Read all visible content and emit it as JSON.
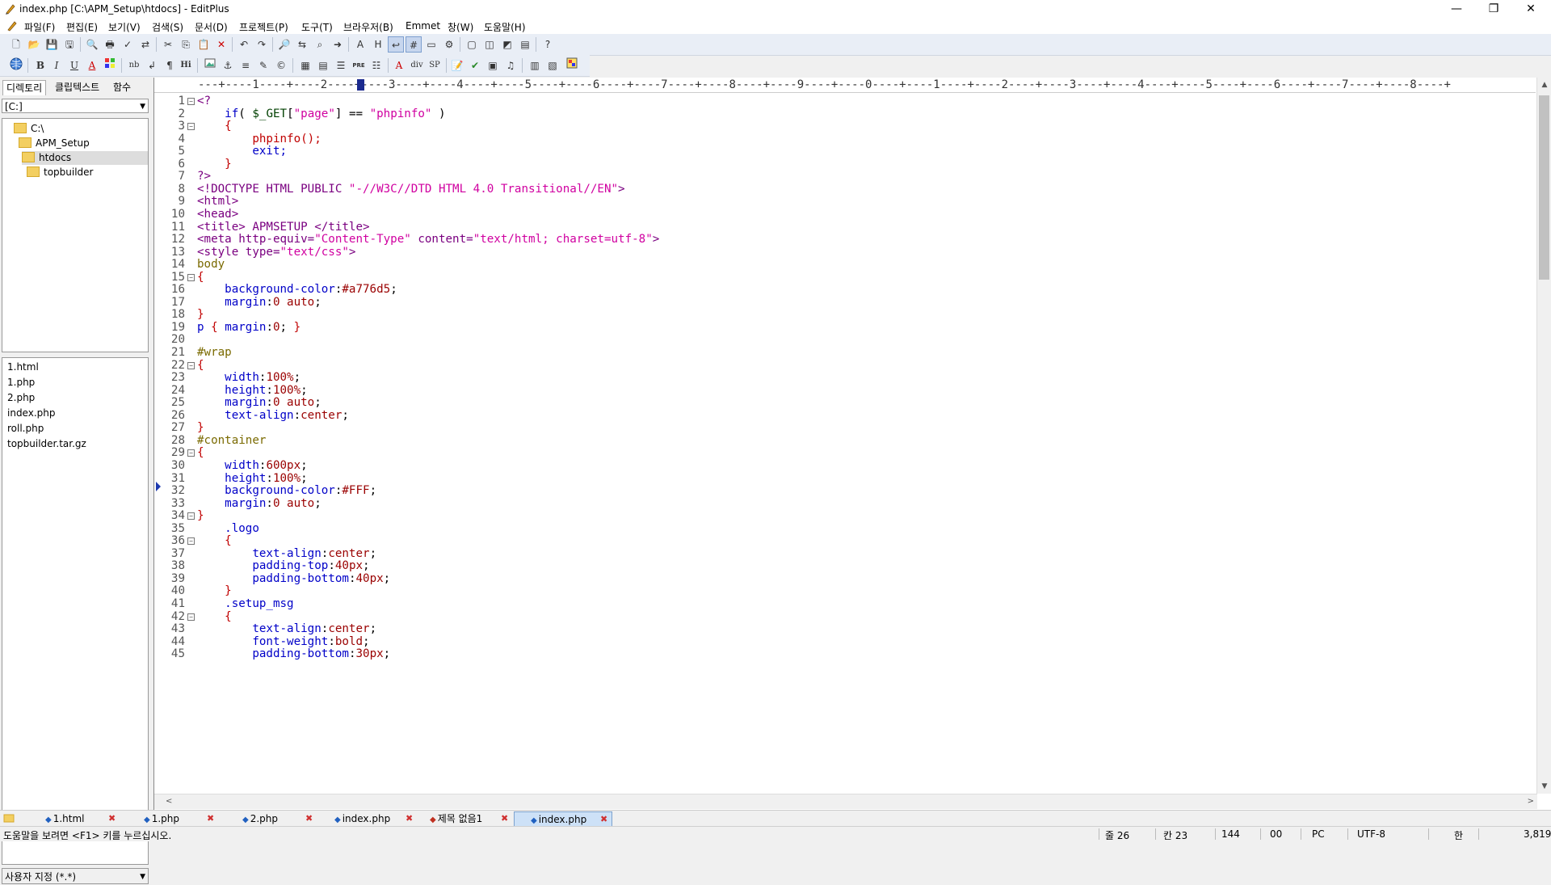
{
  "window": {
    "title": "index.php [C:\\APM_Setup\\htdocs] - EditPlus",
    "minimize": "—",
    "restore": "❐",
    "close": "✕"
  },
  "menu": [
    "파일(F)",
    "편집(E)",
    "보기(V)",
    "검색(S)",
    "문서(D)",
    "프로젝트(P)",
    "도구(T)",
    "브라우저(B)",
    "Emmet",
    "창(W)",
    "도움말(H)"
  ],
  "toolbar": {
    "row1_icons": [
      "new-file-icon",
      "open-file-icon",
      "save-icon",
      "save-all-icon",
      "print-preview-icon",
      "print-icon",
      "spell-check-icon",
      "ftp-icon",
      "cut-icon",
      "copy-icon",
      "paste-icon",
      "delete-icon",
      "undo-icon",
      "redo-icon",
      "find-icon",
      "replace-icon",
      "find-in-files-icon",
      "goto-icon",
      "font-icon",
      "heading-icon",
      "word-wrap-icon",
      "line-numbers-icon",
      "ruler-icon",
      "settings-icon",
      "window-icon",
      "split-icon",
      "browser-icon",
      "directory-icon",
      "help-icon"
    ],
    "row2": [
      "B",
      "I",
      "U",
      "A",
      "nb",
      "¶",
      "Hi",
      "div",
      "SP",
      "PRE"
    ]
  },
  "left_panel": {
    "tabs": [
      "디렉토리",
      "클립텍스트",
      "함수"
    ],
    "drive": "[C:]",
    "tree": [
      "C:\\",
      "APM_Setup",
      "htdocs",
      "topbuilder"
    ],
    "files": [
      "1.html",
      "1.php",
      "2.php",
      "index.php",
      "roll.php",
      "topbuilder.tar.gz"
    ],
    "filter": "사용자 지정 (*.*)"
  },
  "editor": {
    "ruler": "---+----1----+----2----+----3----+----4----+----5----+----6----+----7----+----8----+----9----+----0----+----1----+----2----+----3----+----4----+----5----+----6----+----7----+----8----+"
  },
  "code_lines": [
    {
      "n": "1",
      "fold": true,
      "t": "<?"
    },
    {
      "n": "2",
      "t": "    if( $_GET[\"page\"] == \"phpinfo\" )"
    },
    {
      "n": "3",
      "fold": true,
      "t": "    {"
    },
    {
      "n": "4",
      "t": "        phpinfo();"
    },
    {
      "n": "5",
      "t": "        exit;"
    },
    {
      "n": "6",
      "t": "    }"
    },
    {
      "n": "7",
      "t": "?>"
    },
    {
      "n": "8",
      "t": "<!DOCTYPE HTML PUBLIC \"-//W3C//DTD HTML 4.0 Transitional//EN\">"
    },
    {
      "n": "9",
      "t": "<html>"
    },
    {
      "n": "10",
      "t": "<head>"
    },
    {
      "n": "11",
      "t": "<title> APMSETUP </title>"
    },
    {
      "n": "12",
      "t": "<meta http-equiv=\"Content-Type\" content=\"text/html; charset=utf-8\">"
    },
    {
      "n": "13",
      "t": "<style type=\"text/css\">"
    },
    {
      "n": "14",
      "t": "body"
    },
    {
      "n": "15",
      "fold": true,
      "t": "{"
    },
    {
      "n": "16",
      "t": "    background-color:#a776d5;"
    },
    {
      "n": "17",
      "t": "    margin:0 auto;"
    },
    {
      "n": "18",
      "t": "}"
    },
    {
      "n": "19",
      "t": "p { margin:0; }"
    },
    {
      "n": "20",
      "t": ""
    },
    {
      "n": "21",
      "t": "#wrap"
    },
    {
      "n": "22",
      "fold": true,
      "t": "{"
    },
    {
      "n": "23",
      "t": "    width:100%;"
    },
    {
      "n": "24",
      "t": "    height:100%;"
    },
    {
      "n": "25",
      "t": "    margin:0 auto;"
    },
    {
      "n": "26",
      "t": "    text-align:center;"
    },
    {
      "n": "27",
      "t": "}"
    },
    {
      "n": "28",
      "t": "#container"
    },
    {
      "n": "29",
      "fold": true,
      "t": "{"
    },
    {
      "n": "30",
      "t": "    width:600px;"
    },
    {
      "n": "31",
      "t": "    height:100%;"
    },
    {
      "n": "32",
      "t": "    background-color:#FFF;"
    },
    {
      "n": "33",
      "t": "    margin:0 auto;"
    },
    {
      "n": "34",
      "fold": true,
      "t": "}"
    },
    {
      "n": "35",
      "t": "    .logo"
    },
    {
      "n": "36",
      "fold": true,
      "t": "    {"
    },
    {
      "n": "37",
      "t": "        text-align:center;"
    },
    {
      "n": "38",
      "t": "        padding-top:40px;"
    },
    {
      "n": "39",
      "t": "        padding-bottom:40px;"
    },
    {
      "n": "40",
      "t": "    }"
    },
    {
      "n": "41",
      "t": "    .setup_msg"
    },
    {
      "n": "42",
      "fold": true,
      "t": "    {"
    },
    {
      "n": "43",
      "t": "        text-align:center;"
    },
    {
      "n": "44",
      "t": "        font-weight:bold;"
    },
    {
      "n": "45",
      "t": "        padding-bottom:30px;"
    }
  ],
  "doc_tabs": [
    {
      "label": "1.html",
      "active": false
    },
    {
      "label": "1.php",
      "active": false
    },
    {
      "label": "2.php",
      "active": false
    },
    {
      "label": "index.php",
      "active": false
    },
    {
      "label": "제목 없음1",
      "active": false
    },
    {
      "label": "index.php",
      "active": true
    }
  ],
  "status": {
    "help": "도움말을 보려면 <F1> 키를 누르십시오.",
    "line": "줄 26",
    "col": "칸 23",
    "lines_total": "144",
    "code": "00",
    "eol": "PC",
    "encoding": "UTF-8",
    "ime": "한",
    "size": "3,819"
  }
}
